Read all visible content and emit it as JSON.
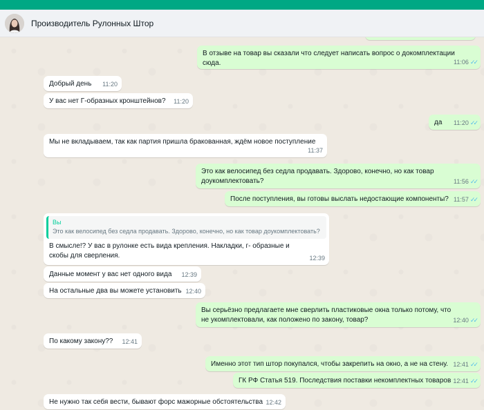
{
  "header": {
    "contact_name": "Производитель Рулонных Штор"
  },
  "messages": [
    {
      "dir": "out",
      "text": "В отзыве на товар вы сказали что следует написать вопрос о докомплектации сюда.",
      "time": "11:06"
    },
    {
      "dir": "in",
      "text": "Добрый день",
      "time": "11:20"
    },
    {
      "dir": "in",
      "text": "У вас нет Г-образных кронштейнов?",
      "time": "11:20"
    },
    {
      "dir": "out",
      "text": "да",
      "time": "11:20"
    },
    {
      "dir": "in",
      "text": "Мы не вкладываем, так как партия пришла бракованная, ждём новое поступление",
      "time": "11:37"
    },
    {
      "dir": "out",
      "text": "Это как велосипед без седла продавать. Здорово, конечно, но как товар доукомплектовать?",
      "time": "11:56"
    },
    {
      "dir": "out",
      "text": "После поступления, вы готовы выслать недостающие компоненты?",
      "time": "11:57"
    },
    {
      "dir": "in",
      "quote_name": "Вы",
      "quote_text": "Это как велосипед без седла продавать. Здорово, конечно, но как товар доукомплектовать?",
      "text": "В смысле!? У вас в рулонке есть вида крепления. Накладки, г- образные и скобы для сверления.",
      "time": "12:39"
    },
    {
      "dir": "in",
      "text": "Данные  момент у вас нет одного вида",
      "time": "12:39"
    },
    {
      "dir": "in",
      "text": "На остальные два вы можете установить",
      "time": "12:40"
    },
    {
      "dir": "out",
      "text": "Вы серьёзно предлагаете мне сверлить пластиковые окна только потому, что не укомплектовали, как положено по закону, товар?",
      "time": "12:40"
    },
    {
      "dir": "in",
      "text": "По какому закону??",
      "time": "12:41"
    },
    {
      "dir": "out",
      "text": "Именно этот тип штор покупался, чтобы закрепить на окно, а не на стену.",
      "time": "12:41"
    },
    {
      "dir": "out",
      "text": "ГК РФ Статья 519. Последствия поставки некомплектных товаров",
      "time": "12:41"
    },
    {
      "dir": "in",
      "text": "Не нужно так себя вести, бывают форс мажорные обстоятельства",
      "time": "12:42"
    }
  ]
}
